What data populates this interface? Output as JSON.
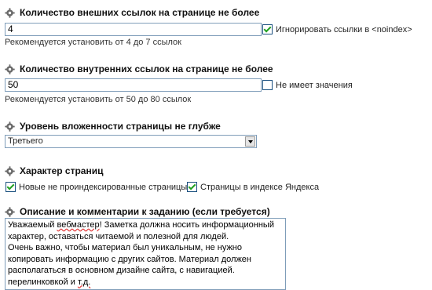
{
  "external_links": {
    "title": "Количество внешних ссылок на странице не более",
    "value": "4",
    "checkbox_label": "Игнорировать ссылки в <noindex>",
    "checkbox_checked": true,
    "hint": "Рекомендуется установить от 4 до 7 ссылок"
  },
  "internal_links": {
    "title": "Количество внутренних ссылок на странице не более",
    "value": "50",
    "checkbox_label": "Не имеет значения",
    "checkbox_checked": false,
    "hint": "Рекомендуется установить от 50 до 80 ссылок"
  },
  "nesting": {
    "title": "Уровень вложенности страницы не глубже",
    "selected": "Третьего"
  },
  "pages": {
    "title": "Характер страниц",
    "option1": "Новые не проиндексированные страницы",
    "option1_checked": true,
    "option2": "Страницы в индексе Яндекса",
    "option2_checked": true
  },
  "description": {
    "title": "Описание и комментарии к заданию (если требуется)",
    "line1_pre": "Уважаемый ",
    "line1_wavy": "вебмастер",
    "line1_post": "! Заметка должна носить информационный",
    "line2": "характер, оставаться читаемой и полезной для людей.",
    "line3": "Очень важно, чтобы материал был уникальным, не нужно",
    "line4": "копировать информацию с других сайтов. Материал должен",
    "line5": "располагаться в основном дизайне сайта, с навигацией.",
    "line6_pre": "перелинковкой и ",
    "line6_wavy": "т.д."
  },
  "icon_colors": {
    "gear": "#5a5a5a"
  }
}
